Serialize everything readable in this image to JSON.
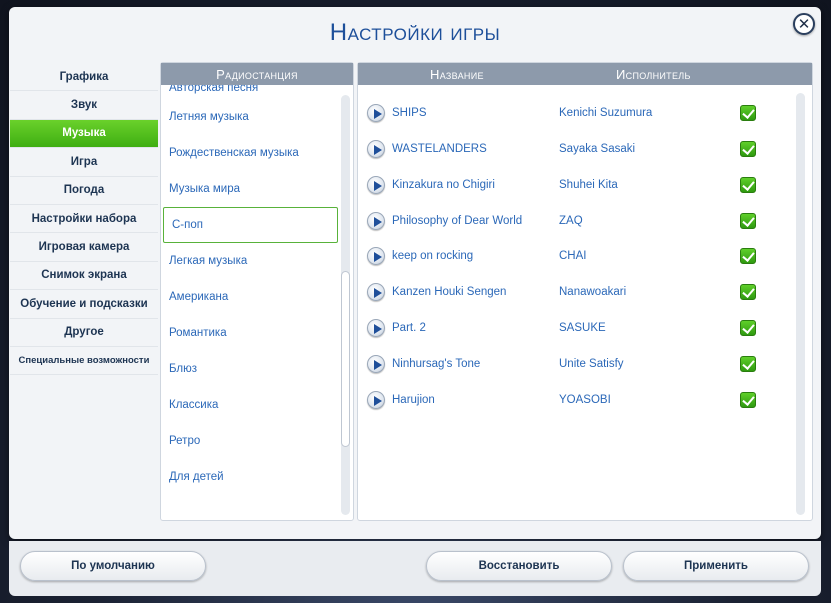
{
  "dialog": {
    "title": "Настройки игры"
  },
  "sidebar": {
    "items": [
      {
        "label": "Графика"
      },
      {
        "label": "Звук"
      },
      {
        "label": "Музыка",
        "active": true
      },
      {
        "label": "Игра"
      },
      {
        "label": "Погода"
      },
      {
        "label": "Настройки набора"
      },
      {
        "label": "Игровая камера"
      },
      {
        "label": "Снимок экрана"
      },
      {
        "label": "Обучение и подсказки"
      },
      {
        "label": "Другое"
      },
      {
        "label": "Специальные возможности"
      }
    ]
  },
  "stations": {
    "header": "Радиостанция",
    "items": [
      "Авторская песня",
      "Летняя музыка",
      "Рождественская музыка",
      "Музыка мира",
      "C-поп",
      "Легкая музыка",
      "Американа",
      "Романтика",
      "Блюз",
      "Классика",
      "Ретро",
      "Для детей"
    ],
    "selected": "C-поп"
  },
  "songs": {
    "header_name": "Название",
    "header_artist": "Исполнитель",
    "rows": [
      {
        "name": "SHIPS",
        "artist": "Kenichi Suzumura",
        "enabled": true
      },
      {
        "name": "WASTELANDERS",
        "artist": "Sayaka Sasaki",
        "enabled": true
      },
      {
        "name": "Kinzakura no Chigiri",
        "artist": "Shuhei Kita",
        "enabled": true
      },
      {
        "name": "Philosophy of Dear World",
        "artist": "ZAQ",
        "enabled": true
      },
      {
        "name": "keep on rocking",
        "artist": "CHAI",
        "enabled": true
      },
      {
        "name": "Kanzen Houki Sengen",
        "artist": "Nanawoakari",
        "enabled": true
      },
      {
        "name": "Part. 2",
        "artist": "SASUKE",
        "enabled": true
      },
      {
        "name": "Ninhursag's Tone",
        "artist": "Unite Satisfy",
        "enabled": true
      },
      {
        "name": "Harujion",
        "artist": "YOASOBI",
        "enabled": true
      }
    ]
  },
  "footer": {
    "default_label": "По умолчанию",
    "restore_label": "Восстановить",
    "apply_label": "Применить"
  },
  "colors": {
    "accent_blue": "#1d4f9a",
    "active_green": "#4fbd1c",
    "link_blue": "#2b68b8"
  }
}
